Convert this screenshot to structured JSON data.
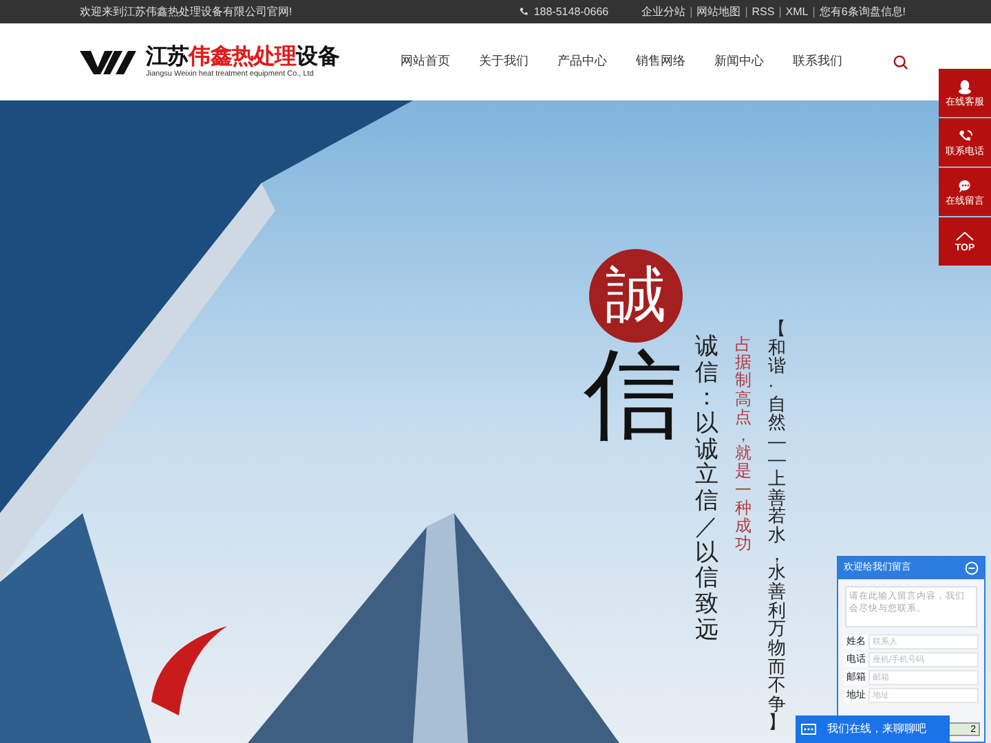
{
  "top_bar": {
    "welcome": "欢迎来到江苏伟鑫热处理设备有限公司官网!",
    "phone": "188-5148-0666",
    "links": [
      "企业分站",
      "网站地图",
      "RSS",
      "XML",
      "您有6条询盘信息!"
    ],
    "separator": "|"
  },
  "logo": {
    "name_parts": [
      {
        "text": "江苏",
        "highlight": false
      },
      {
        "text": "伟鑫热处理",
        "highlight": true
      },
      {
        "text": "设备",
        "highlight": false
      }
    ],
    "subtitle": "Jiangsu Weixin heat treatment equipment Co., Ltd"
  },
  "nav": [
    {
      "label": "网站首页"
    },
    {
      "label": "关于我们"
    },
    {
      "label": "产品中心"
    },
    {
      "label": "销售网络"
    },
    {
      "label": "新闻中心"
    },
    {
      "label": "联系我们"
    }
  ],
  "hero": {
    "seal_char": "誠",
    "big_char": "信",
    "motto": "【和谐·自然——上善若水，水善利万物而不争】",
    "slogan": "占据制高点，就是一种成功",
    "creed": "诚信：以诚立信／以信致远"
  },
  "side_bar": [
    {
      "kind": "service",
      "label": "在线客服"
    },
    {
      "kind": "phone",
      "label": "联系电话"
    },
    {
      "kind": "message",
      "label": "在线留言"
    },
    {
      "kind": "top",
      "label": "TOP"
    }
  ],
  "message_box": {
    "title": "欢迎给我们留言",
    "content_placeholder": "请在此输入留言内容，我们会尽快与您联系。",
    "fields": [
      {
        "label": "姓名",
        "placeholder": "联系人"
      },
      {
        "label": "电话",
        "placeholder": "座机/手机号码"
      },
      {
        "label": "邮箱",
        "placeholder": "邮箱"
      },
      {
        "label": "地址",
        "placeholder": "地址"
      }
    ],
    "captcha": "2"
  },
  "chat_bar": {
    "label": "我们在线，来聊聊吧"
  }
}
